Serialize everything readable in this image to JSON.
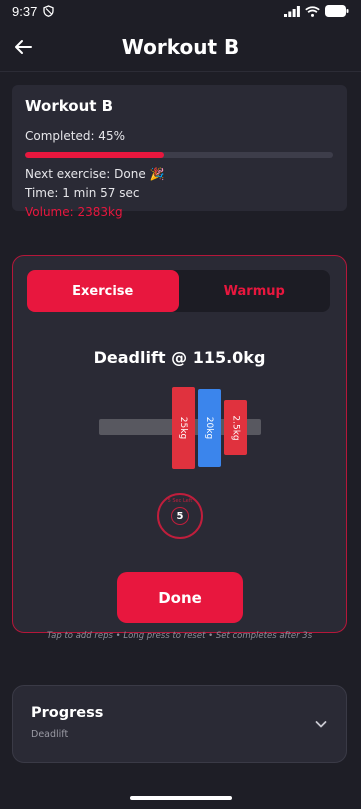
{
  "status_bar": {
    "time": "9:37"
  },
  "app_bar": {
    "title": "Workout B"
  },
  "summary": {
    "title": "Workout B",
    "completed": "Completed: 45%",
    "progress_fraction": 0.45,
    "next_exercise": "Next exercise: Done 🎉",
    "time": "Time: 1 min 57 sec",
    "volume": "Volume: 2383kg"
  },
  "exercise_card": {
    "tabs": [
      {
        "label": "Exercise",
        "active": true
      },
      {
        "label": "Warmup",
        "active": false
      }
    ],
    "heading": "Deadlift @ 115.0kg",
    "plates": [
      {
        "label": "25kg",
        "color": "#e0323e"
      },
      {
        "label": "20kg",
        "color": "#3b85ec"
      },
      {
        "label": "2.5kg",
        "color": "#e0323e"
      }
    ],
    "rep_counter": {
      "arc_text": "5 Sec Left",
      "value": "5"
    },
    "done_label": "Done",
    "hint": "Tap to add reps • Long press to reset • Set completes after 3s"
  },
  "progress_section": {
    "title": "Progress",
    "subtitle": "Deadlift"
  },
  "colors": {
    "accent": "#e8173e",
    "background": "#1e1e26",
    "card": "#2a2a35"
  },
  "icons": {
    "back": "arrow-left-icon",
    "expand": "chevron-down-icon"
  }
}
